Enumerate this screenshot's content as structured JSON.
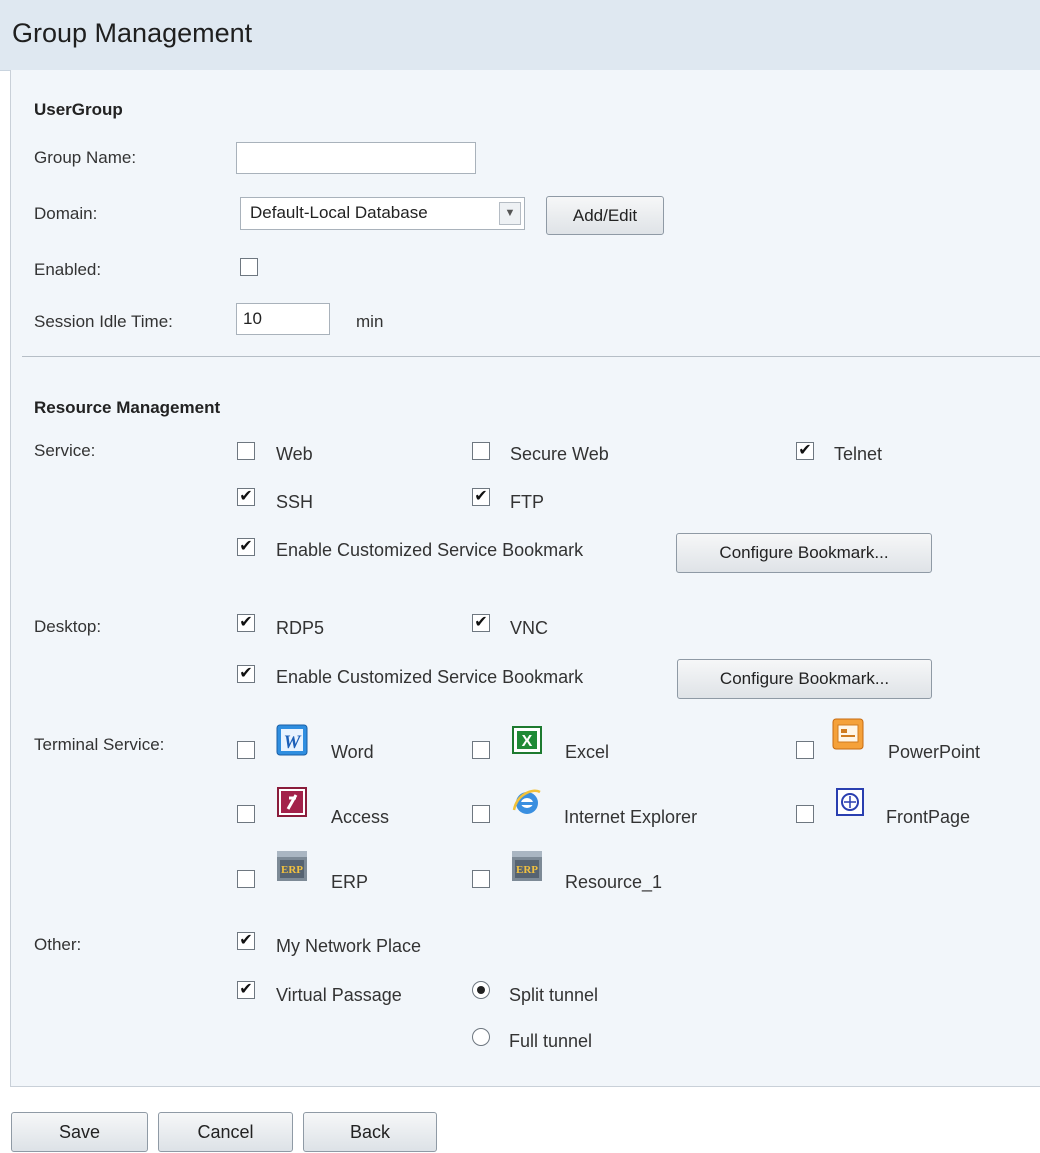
{
  "header": {
    "title": "Group Management"
  },
  "usergroup": {
    "section_title": "UserGroup",
    "group_name_label": "Group Name:",
    "group_name_value": "",
    "domain_label": "Domain:",
    "domain_selected": "Default-Local Database",
    "add_edit_label": "Add/Edit",
    "enabled_label": "Enabled:",
    "enabled_checked": false,
    "session_idle_label": "Session Idle Time:",
    "session_idle_value": "10",
    "session_idle_unit": "min"
  },
  "resource": {
    "section_title": "Resource Management",
    "service_label": "Service:",
    "service_options": [
      {
        "label": "Web",
        "checked": false
      },
      {
        "label": "Secure Web",
        "checked": false
      },
      {
        "label": "Telnet",
        "checked": true
      },
      {
        "label": "SSH",
        "checked": true
      },
      {
        "label": "FTP",
        "checked": true
      }
    ],
    "service_bookmark_label": "Enable Customized Service Bookmark",
    "service_bookmark_checked": true,
    "service_configure_label": "Configure Bookmark...",
    "desktop_label": "Desktop:",
    "desktop_options": [
      {
        "label": "RDP5",
        "checked": true
      },
      {
        "label": "VNC",
        "checked": true
      }
    ],
    "desktop_bookmark_label": "Enable Customized Service Bookmark",
    "desktop_bookmark_checked": true,
    "desktop_configure_label": "Configure Bookmark...",
    "terminal_label": "Terminal Service:",
    "terminal_options": [
      {
        "label": "Word",
        "checked": false,
        "icon": "word-icon"
      },
      {
        "label": "Excel",
        "checked": false,
        "icon": "excel-icon"
      },
      {
        "label": "PowerPoint",
        "checked": false,
        "icon": "powerpoint-icon"
      },
      {
        "label": "Access",
        "checked": false,
        "icon": "access-icon"
      },
      {
        "label": "Internet Explorer",
        "checked": false,
        "icon": "internet-explorer-icon"
      },
      {
        "label": "FrontPage",
        "checked": false,
        "icon": "frontpage-icon"
      },
      {
        "label": "ERP",
        "checked": false,
        "icon": "erp-icon"
      },
      {
        "label": "Resource_1",
        "checked": false,
        "icon": "erp-icon"
      }
    ],
    "other_label": "Other:",
    "my_network_label": "My Network Place",
    "my_network_checked": true,
    "virtual_passage_label": "Virtual Passage",
    "virtual_passage_checked": true,
    "split_tunnel_label": "Split tunnel",
    "full_tunnel_label": "Full tunnel",
    "tunnel_selected": "Split tunnel"
  },
  "footer": {
    "save_label": "Save",
    "cancel_label": "Cancel",
    "back_label": "Back"
  },
  "colors": {
    "header_bg": "#dfe8f1",
    "panel_bg": "#f2f6fa",
    "button_border": "#8f9aa5"
  }
}
